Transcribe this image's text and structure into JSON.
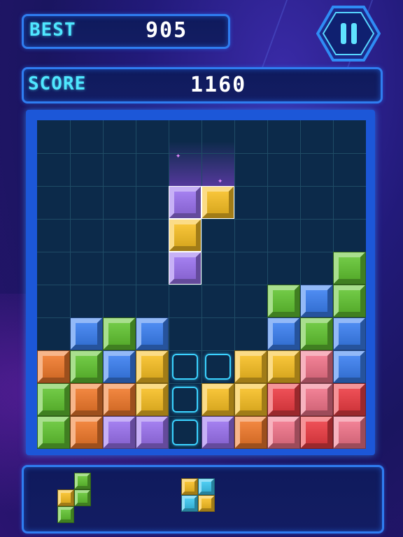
{
  "best": {
    "label": "BEST",
    "value": "905"
  },
  "score": {
    "label": "SCORE",
    "value": "1160"
  },
  "pause_button": {
    "icon": "pause-icon"
  },
  "colors": {
    "orange": "#f07a2c",
    "green": "#62c432",
    "blue": "#3b7ff0",
    "yellow": "#f7bf24",
    "pink": "#f0748a",
    "red": "#ec3d44",
    "purple": "#9a72ee",
    "cyan": "#3cc7f0"
  },
  "board": {
    "columns": 10,
    "rows": 10,
    "placed": [
      {
        "r": 4,
        "c": 9,
        "color": "green"
      },
      {
        "r": 5,
        "c": 7,
        "color": "green"
      },
      {
        "r": 5,
        "c": 8,
        "color": "blue"
      },
      {
        "r": 5,
        "c": 9,
        "color": "green"
      },
      {
        "r": 6,
        "c": 1,
        "color": "blue"
      },
      {
        "r": 6,
        "c": 2,
        "color": "green"
      },
      {
        "r": 6,
        "c": 3,
        "color": "blue"
      },
      {
        "r": 6,
        "c": 7,
        "color": "blue"
      },
      {
        "r": 6,
        "c": 8,
        "color": "green"
      },
      {
        "r": 6,
        "c": 9,
        "color": "blue"
      },
      {
        "r": 7,
        "c": 0,
        "color": "orange"
      },
      {
        "r": 7,
        "c": 1,
        "color": "green"
      },
      {
        "r": 7,
        "c": 2,
        "color": "blue"
      },
      {
        "r": 7,
        "c": 3,
        "color": "yellow"
      },
      {
        "r": 7,
        "c": 6,
        "color": "yellow"
      },
      {
        "r": 7,
        "c": 7,
        "color": "yellow"
      },
      {
        "r": 7,
        "c": 8,
        "color": "pink"
      },
      {
        "r": 7,
        "c": 9,
        "color": "blue"
      },
      {
        "r": 8,
        "c": 0,
        "color": "green"
      },
      {
        "r": 8,
        "c": 1,
        "color": "orange"
      },
      {
        "r": 8,
        "c": 2,
        "color": "orange"
      },
      {
        "r": 8,
        "c": 3,
        "color": "yellow"
      },
      {
        "r": 8,
        "c": 5,
        "color": "yellow"
      },
      {
        "r": 8,
        "c": 6,
        "color": "yellow"
      },
      {
        "r": 8,
        "c": 7,
        "color": "red"
      },
      {
        "r": 8,
        "c": 8,
        "color": "pink"
      },
      {
        "r": 8,
        "c": 9,
        "color": "red"
      },
      {
        "r": 9,
        "c": 0,
        "color": "green"
      },
      {
        "r": 9,
        "c": 1,
        "color": "orange"
      },
      {
        "r": 9,
        "c": 2,
        "color": "purple"
      },
      {
        "r": 9,
        "c": 3,
        "color": "purple"
      },
      {
        "r": 9,
        "c": 5,
        "color": "purple"
      },
      {
        "r": 9,
        "c": 6,
        "color": "orange"
      },
      {
        "r": 9,
        "c": 7,
        "color": "pink"
      },
      {
        "r": 9,
        "c": 8,
        "color": "red"
      },
      {
        "r": 9,
        "c": 9,
        "color": "pink"
      }
    ],
    "falling_piece": [
      {
        "r": 2,
        "c": 4,
        "color": "purple"
      },
      {
        "r": 2,
        "c": 5,
        "color": "yellow"
      },
      {
        "r": 3,
        "c": 4,
        "color": "yellow"
      },
      {
        "r": 4,
        "c": 4,
        "color": "purple"
      }
    ],
    "empty_slots": [
      {
        "r": 7,
        "c": 4
      },
      {
        "r": 7,
        "c": 5
      },
      {
        "r": 8,
        "c": 4
      },
      {
        "r": 9,
        "c": 4
      }
    ]
  },
  "next_pieces": [
    {
      "name": "next-piece-s",
      "blocks": [
        {
          "r": 0,
          "c": 1,
          "color": "green"
        },
        {
          "r": 1,
          "c": 0,
          "color": "yellow"
        },
        {
          "r": 1,
          "c": 1,
          "color": "green"
        },
        {
          "r": 2,
          "c": 0,
          "color": "green"
        }
      ]
    },
    {
      "name": "next-piece-square",
      "blocks": [
        {
          "r": 0,
          "c": 0,
          "color": "yellow"
        },
        {
          "r": 0,
          "c": 1,
          "color": "cyan"
        },
        {
          "r": 1,
          "c": 0,
          "color": "cyan"
        },
        {
          "r": 1,
          "c": 1,
          "color": "yellow"
        }
      ]
    }
  ]
}
